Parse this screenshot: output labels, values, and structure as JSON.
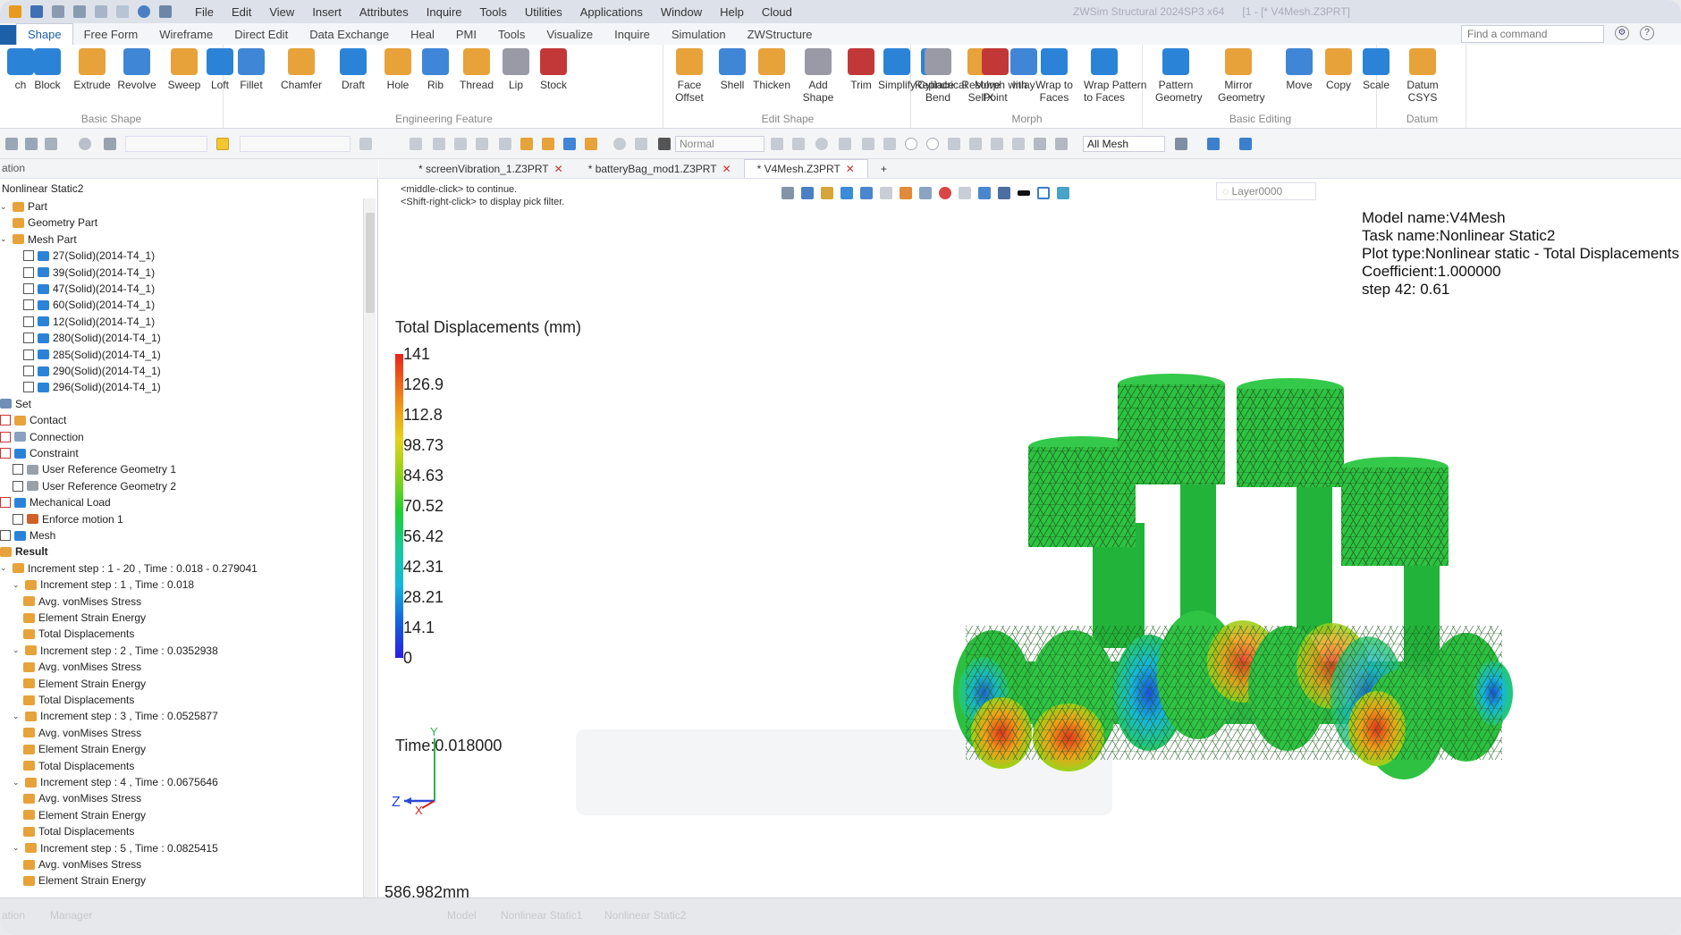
{
  "titlebar": {
    "menu": [
      "File",
      "Edit",
      "View",
      "Insert",
      "Attributes",
      "Inquire",
      "Tools",
      "Utilities",
      "Applications",
      "Window",
      "Help",
      "Cloud"
    ],
    "app_title": "ZWSim Structural 2024SP3 x64",
    "doc_title": "[1 - [* V4Mesh.Z3PRT]"
  },
  "ribbon_tabs": [
    "Shape",
    "Free Form",
    "Wireframe",
    "Direct Edit",
    "Data Exchange",
    "Heal",
    "PMI",
    "Tools",
    "Visualize",
    "Inquire",
    "Simulation",
    "ZWStructure"
  ],
  "search_placeholder": "Find a command",
  "ribbon_groups": [
    {
      "label": "Basic Shape",
      "tools": [
        {
          "name": "ch",
          "label": "ch"
        },
        {
          "name": "block",
          "label": "Block"
        },
        {
          "name": "extrude",
          "label": "Extrude"
        },
        {
          "name": "revolve",
          "label": "Revolve"
        },
        {
          "name": "sweep",
          "label": "Sweep"
        },
        {
          "name": "loft",
          "label": "Loft"
        }
      ]
    },
    {
      "label": "Engineering Feature",
      "tools": [
        {
          "name": "fillet",
          "label": "Fillet"
        },
        {
          "name": "chamfer",
          "label": "Chamfer"
        },
        {
          "name": "draft",
          "label": "Draft"
        },
        {
          "name": "hole",
          "label": "Hole"
        },
        {
          "name": "rib",
          "label": "Rib"
        },
        {
          "name": "thread",
          "label": "Thread"
        },
        {
          "name": "lip",
          "label": "Lip"
        },
        {
          "name": "stock",
          "label": "Stock"
        }
      ]
    },
    {
      "label": "Edit Shape",
      "tools": [
        {
          "name": "face-offset",
          "label": "Face",
          "label2": "Offset"
        },
        {
          "name": "shell",
          "label": "Shell"
        },
        {
          "name": "thicken",
          "label": "Thicken"
        },
        {
          "name": "add-shape",
          "label": "Add",
          "label2": "Shape"
        },
        {
          "name": "trim",
          "label": "Trim"
        },
        {
          "name": "simplify",
          "label": "Simplify"
        },
        {
          "name": "replace",
          "label": "Replace"
        },
        {
          "name": "resolve-selfx",
          "label": "Resolve",
          "label2": "SelfX"
        },
        {
          "name": "inlay",
          "label": "Inlay"
        }
      ]
    },
    {
      "label": "Morph",
      "tools": [
        {
          "name": "cylindrical-bend",
          "label": "Cylindrical",
          "label2": "Bend"
        },
        {
          "name": "morph-with-point",
          "label": "Morph with",
          "label2": "Point"
        },
        {
          "name": "wrap-to-faces",
          "label": "Wrap to",
          "label2": "Faces"
        },
        {
          "name": "wrap-pattern-to-faces",
          "label": "Wrap Pattern",
          "label2": "to Faces"
        }
      ]
    },
    {
      "label": "Basic Editing",
      "tools": [
        {
          "name": "pattern-geometry",
          "label": "Pattern",
          "label2": "Geometry"
        },
        {
          "name": "mirror-geometry",
          "label": "Mirror",
          "label2": "Geometry"
        },
        {
          "name": "move",
          "label": "Move"
        },
        {
          "name": "copy",
          "label": "Copy"
        },
        {
          "name": "scale",
          "label": "Scale"
        }
      ]
    },
    {
      "label": "Datum",
      "tools": [
        {
          "name": "datum-csys",
          "label": "Datum",
          "label2": "CSYS"
        }
      ]
    }
  ],
  "toolbar": {
    "render_mode": "Normal",
    "filter": "All Mesh"
  },
  "left_panel": {
    "title": "ation",
    "root": "Nonlinear Static2",
    "items": [
      {
        "label": "Part",
        "level": 0,
        "cb": false,
        "caret": "v",
        "icon": "part"
      },
      {
        "label": "Geometry Part",
        "level": 1,
        "cb": false,
        "caret": "",
        "icon": "geometry"
      },
      {
        "label": "Mesh Part",
        "level": 0,
        "cb": false,
        "caret": "v",
        "icon": "meshpart"
      },
      {
        "label": "27(Solid)(2014-T4_1)",
        "level": 2,
        "cb": true,
        "icon": "solid"
      },
      {
        "label": "39(Solid)(2014-T4_1)",
        "level": 2,
        "cb": true,
        "icon": "solid"
      },
      {
        "label": "47(Solid)(2014-T4_1)",
        "level": 2,
        "cb": true,
        "icon": "solid"
      },
      {
        "label": "60(Solid)(2014-T4_1)",
        "level": 2,
        "cb": true,
        "icon": "solid"
      },
      {
        "label": "12(Solid)(2014-T4_1)",
        "level": 2,
        "cb": true,
        "icon": "solid"
      },
      {
        "label": "280(Solid)(2014-T4_1)",
        "level": 2,
        "cb": true,
        "icon": "solid"
      },
      {
        "label": "285(Solid)(2014-T4_1)",
        "level": 2,
        "cb": true,
        "icon": "solid"
      },
      {
        "label": "290(Solid)(2014-T4_1)",
        "level": 2,
        "cb": true,
        "icon": "solid"
      },
      {
        "label": "296(Solid)(2014-T4_1)",
        "level": 2,
        "cb": true,
        "icon": "solid"
      },
      {
        "label": "Set",
        "level": 0,
        "cb": false,
        "caret": "",
        "icon": "set"
      },
      {
        "label": "Contact",
        "level": 0,
        "cb": true,
        "red": true,
        "icon": "contact"
      },
      {
        "label": "Connection",
        "level": 0,
        "cb": true,
        "red": true,
        "icon": "connection"
      },
      {
        "label": "Constraint",
        "level": 0,
        "cb": true,
        "red": true,
        "icon": "constraint"
      },
      {
        "label": "User Reference Geometry 1",
        "level": 1,
        "cb": true,
        "icon": "refgeom"
      },
      {
        "label": "User Reference Geometry 2",
        "level": 1,
        "cb": true,
        "icon": "refgeom"
      },
      {
        "label": "Mechanical Load",
        "level": 0,
        "cb": true,
        "red": true,
        "icon": "load"
      },
      {
        "label": "Enforce motion 1",
        "level": 1,
        "cb": true,
        "icon": "motion"
      },
      {
        "label": "Mesh",
        "level": 0,
        "cb": true,
        "icon": "mesh"
      },
      {
        "label": "Result",
        "level": 0,
        "cb": false,
        "bold": true,
        "icon": "result"
      },
      {
        "label": "Increment step : 1 - 20 , Time : 0.018 - 0.279041",
        "level": 0,
        "cb": false,
        "caret": "v",
        "icon": "inc"
      },
      {
        "label": "Increment step : 1 , Time : 0.018",
        "level": 1,
        "cb": false,
        "caret": "v",
        "icon": "inc"
      },
      {
        "label": "Avg. vonMises Stress",
        "level": 2,
        "cb": false,
        "icon": "res"
      },
      {
        "label": "Element Strain Energy",
        "level": 2,
        "cb": false,
        "icon": "res"
      },
      {
        "label": "Total Displacements",
        "level": 2,
        "cb": false,
        "icon": "res"
      },
      {
        "label": "Increment step : 2 , Time : 0.0352938",
        "level": 1,
        "cb": false,
        "caret": "v",
        "icon": "inc"
      },
      {
        "label": "Avg. vonMises Stress",
        "level": 2,
        "cb": false,
        "icon": "res"
      },
      {
        "label": "Element Strain Energy",
        "level": 2,
        "cb": false,
        "icon": "res"
      },
      {
        "label": "Total Displacements",
        "level": 2,
        "cb": false,
        "icon": "res"
      },
      {
        "label": "Increment step : 3 , Time : 0.0525877",
        "level": 1,
        "cb": false,
        "caret": "v",
        "icon": "inc"
      },
      {
        "label": "Avg. vonMises Stress",
        "level": 2,
        "cb": false,
        "icon": "res"
      },
      {
        "label": "Element Strain Energy",
        "level": 2,
        "cb": false,
        "icon": "res"
      },
      {
        "label": "Total Displacements",
        "level": 2,
        "cb": false,
        "icon": "res"
      },
      {
        "label": "Increment step : 4 , Time : 0.0675646",
        "level": 1,
        "cb": false,
        "caret": "v",
        "icon": "inc"
      },
      {
        "label": "Avg. vonMises Stress",
        "level": 2,
        "cb": false,
        "icon": "res"
      },
      {
        "label": "Element Strain Energy",
        "level": 2,
        "cb": false,
        "icon": "res"
      },
      {
        "label": "Total Displacements",
        "level": 2,
        "cb": false,
        "icon": "res"
      },
      {
        "label": "Increment step : 5 , Time : 0.0825415",
        "level": 1,
        "cb": false,
        "caret": "v",
        "icon": "inc"
      },
      {
        "label": "Avg. vonMises Stress",
        "level": 2,
        "cb": false,
        "icon": "res"
      },
      {
        "label": "Element Strain Energy",
        "level": 2,
        "cb": false,
        "icon": "res"
      }
    ]
  },
  "doc_tabs": [
    {
      "label": "* screenVibration_1.Z3PRT",
      "active": false
    },
    {
      "label": "* batteryBag_mod1.Z3PRT",
      "active": false
    },
    {
      "label": "* V4Mesh.Z3PRT",
      "active": true
    }
  ],
  "viewport": {
    "hint1": "<middle-click> to continue.",
    "hint2": "<Shift-right-click> to display pick filter.",
    "layer": "Layer0000",
    "info_lines": [
      "Model name:V4Mesh",
      "Task name:Nonlinear Static2",
      "Plot type:Nonlinear static - Total Displacements",
      "Coefficient:1.000000",
      "step 42:  0.61"
    ],
    "legend_title": "Total Displacements (mm)",
    "legend_ticks": [
      "141",
      "126.9",
      "112.8",
      "98.73",
      "84.63",
      "70.52",
      "56.42",
      "42.31",
      "28.21",
      "14.1",
      "0"
    ],
    "time_label": "Time:0.018000",
    "dimension": "586.982mm",
    "axes": {
      "z": "Z",
      "x": "X",
      "y": "Y"
    }
  },
  "status_bar": {
    "items": [
      "ation",
      "Manager",
      "Model",
      "Nonlinear Static1",
      "Nonlinear Static2"
    ]
  }
}
